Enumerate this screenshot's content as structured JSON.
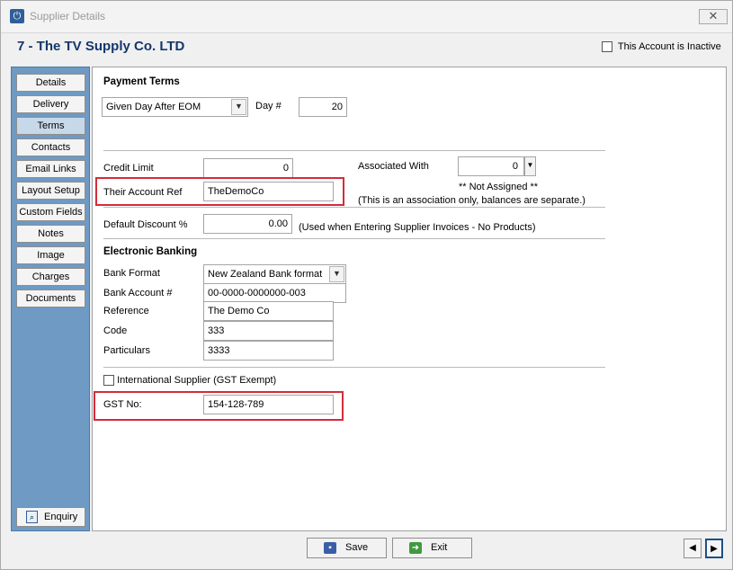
{
  "window": {
    "title": "Supplier Details",
    "close_glyph": "✕"
  },
  "header": {
    "title": "7 - The TV Supply Co. LTD",
    "inactive_label": "This Account is Inactive"
  },
  "sidebar": {
    "items": [
      {
        "label": "Details"
      },
      {
        "label": "Delivery"
      },
      {
        "label": "Terms"
      },
      {
        "label": "Contacts"
      },
      {
        "label": "Email Links"
      },
      {
        "label": "Layout Setup"
      },
      {
        "label": "Custom Fields"
      },
      {
        "label": "Notes"
      },
      {
        "label": "Image"
      },
      {
        "label": "Charges"
      },
      {
        "label": "Documents"
      }
    ],
    "active": "Terms",
    "enquiry_label": "Enquiry"
  },
  "terms": {
    "payment_terms_title": "Payment Terms",
    "payment_terms_value": "Given Day After EOM",
    "day_label": "Day #",
    "day_value": "20",
    "credit_limit_label": "Credit Limit",
    "credit_limit_value": "0",
    "associated_label": "Associated With",
    "associated_value": "0",
    "not_assigned": "** Not Assigned **",
    "association_note": "(This is an association only, balances are separate.)",
    "their_ref_label": "Their Account Ref",
    "their_ref_value": "TheDemoCo",
    "discount_label": "Default Discount %",
    "discount_value": "0.00",
    "discount_note": "(Used when Entering Supplier Invoices - No Products)"
  },
  "banking": {
    "title": "Electronic Banking",
    "format_label": "Bank Format",
    "format_value": "New Zealand Bank format",
    "account_label": "Bank Account #",
    "account_value": "00-0000-0000000-003",
    "reference_label": "Reference",
    "reference_value": "The Demo Co",
    "code_label": "Code",
    "code_value": "333",
    "particulars_label": "Particulars",
    "particulars_value": "3333"
  },
  "gst": {
    "international_label": "International Supplier (GST Exempt)",
    "gst_label": "GST No:",
    "gst_value": "154-128-789"
  },
  "footer": {
    "save_label": "Save",
    "exit_label": "Exit"
  },
  "colors": {
    "title_blue": "#14376b",
    "sidebar_blue": "#6e9ac4",
    "highlight_red": "#d42b3a"
  },
  "icons": {
    "app": "power-icon",
    "enquiry": "magnifier-icon",
    "save": "floppy-disk-icon",
    "exit": "exit-door-icon",
    "prev": "left-arrow-icon",
    "next": "right-arrow-icon"
  }
}
